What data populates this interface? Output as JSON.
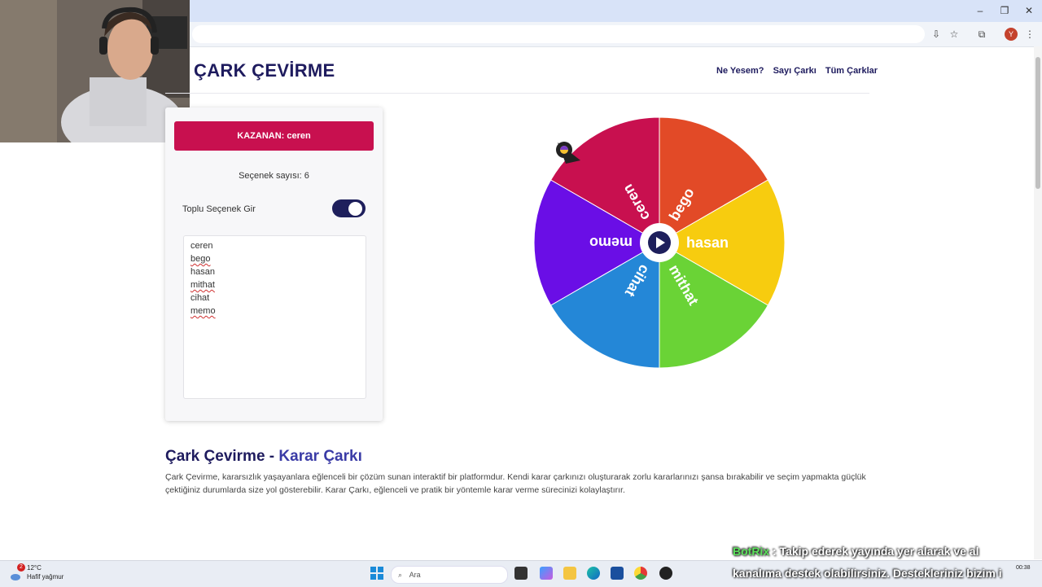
{
  "browser": {
    "window_controls": {
      "minimize": "‒",
      "restore": "❐",
      "close": "✕"
    },
    "profile_initial": "Y"
  },
  "header": {
    "logo": "ÇARK ÇEVİRME",
    "nav": [
      "Ne Yesem?",
      "Sayı Çarkı",
      "Tüm Çarklar"
    ]
  },
  "panel": {
    "winner": "KAZANAN: ceren",
    "option_count": "Seçenek sayısı: 6",
    "bulk_label": "Toplu Seçenek Gir",
    "bulk_toggle_on": true,
    "options": [
      "ceren",
      "bego",
      "hasan",
      "mithat",
      "cihat",
      "memo"
    ]
  },
  "wheel": {
    "segments": [
      {
        "label": "bego",
        "color": "#e24a27"
      },
      {
        "label": "hasan",
        "color": "#f7cc0f"
      },
      {
        "label": "mithat",
        "color": "#6ad336"
      },
      {
        "label": "cihat",
        "color": "#2487d7"
      },
      {
        "label": "memo",
        "color": "#6a0ee6"
      },
      {
        "label": "ceren",
        "color": "#c8104f"
      }
    ],
    "center_button": "play-button"
  },
  "content": {
    "title_part1": "Çark Çevirme - ",
    "title_part2": "Karar Çarkı",
    "paragraph": "Çark Çevirme, kararsızlık yaşayanlara eğlenceli bir çözüm sunan interaktif bir platformdur. Kendi karar çarkınızı oluşturarak zorlu kararlarınızı şansa bırakabilir ve seçim yapmakta güçlük çektiğiniz durumlarda size yol gösterebilir. Karar Çarkı, eğlenceli ve pratik bir yöntemle karar verme sürecinizi kolaylaştırır."
  },
  "taskbar": {
    "weather_temp": "12°C",
    "weather_desc": "Hafif yağmur",
    "weather_badge": "2",
    "search_placeholder": "Ara",
    "clock": "00:38"
  },
  "overlay": {
    "bot_name": "BotRix",
    "line1": " : Takip ederek yayında yer alarak ve al",
    "line2": "kanalıma destek olabilirsiniz. Destekleriniz bizim i"
  }
}
